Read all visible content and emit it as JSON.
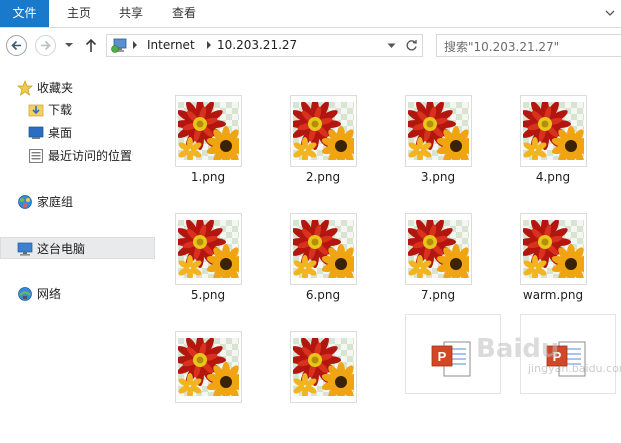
{
  "ribbon": {
    "tabs": [
      {
        "label": "文件"
      },
      {
        "label": "主页"
      },
      {
        "label": "共享"
      },
      {
        "label": "查看"
      }
    ]
  },
  "address": {
    "crumbs": [
      "Internet",
      "10.203.21.27"
    ]
  },
  "search": {
    "placeholder": "搜索\"10.203.21.27\""
  },
  "navpane": {
    "favorites": {
      "label": "收藏夹"
    },
    "favorites_items": [
      {
        "label": "下载"
      },
      {
        "label": "桌面"
      },
      {
        "label": "最近访问的位置"
      }
    ],
    "homegroup": {
      "label": "家庭组"
    },
    "thispc": {
      "label": "这台电脑"
    },
    "network": {
      "label": "网络"
    }
  },
  "files": [
    {
      "name": "1.png"
    },
    {
      "name": "2.png"
    },
    {
      "name": "3.png"
    },
    {
      "name": "4.png"
    },
    {
      "name": "5.png"
    },
    {
      "name": "6.png"
    },
    {
      "name": "7.png"
    },
    {
      "name": "warm.png"
    },
    {
      "name": ""
    },
    {
      "name": ""
    },
    {
      "name": ""
    },
    {
      "name": ""
    }
  ],
  "watermark": {
    "text": "Baidu",
    "sub": "jingyan.baidu.com"
  },
  "colors": {
    "accent": "#1979ca",
    "selection": "#e9eaeb"
  }
}
